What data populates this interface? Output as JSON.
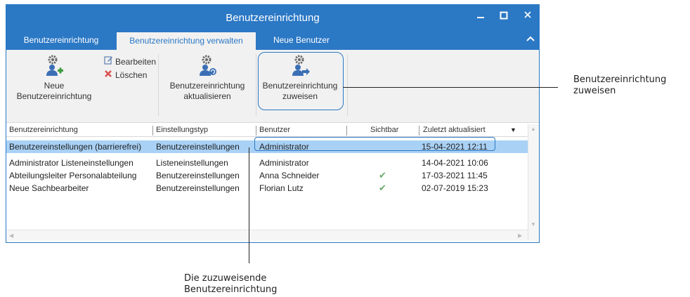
{
  "window": {
    "title": "Benutzereinrichtung",
    "controls": {
      "minimize": "‒",
      "maximize": "▫",
      "close": "✕"
    }
  },
  "tabs": [
    {
      "label": "Benutzereinrichtung",
      "active": false
    },
    {
      "label": "Benutzereinrichtung verwalten",
      "active": true
    },
    {
      "label": "Neue Benutzer",
      "active": false
    }
  ],
  "ribbon": {
    "neu_label_1": "Neue",
    "neu_label_2": "Benutzereinrichtung",
    "bearbeiten_label": "Bearbeiten",
    "loeschen_label": "Löschen",
    "aktualisieren_label_1": "Benutzereinrichtung",
    "aktualisieren_label_2": "aktualisieren",
    "zuweisen_label_1": "Benutzereinrichtung",
    "zuweisen_label_2": "zuweisen",
    "icons": {
      "neu": "gear-user-plus-icon",
      "bearbeiten": "edit-icon",
      "loeschen": "delete-x-icon",
      "aktualisieren": "gear-user-refresh-icon",
      "zuweisen": "gear-user-arrow-icon"
    }
  },
  "grid": {
    "columns": [
      "Benutzereinrichtung",
      "Einstellungstyp",
      "Benutzer",
      "Sichtbar",
      "Zuletzt aktualisiert"
    ],
    "rows": [
      {
        "name": "Benutzereinstellungen (barrierefrei)",
        "type": "Benutzereinstellungen",
        "user": "Administrator",
        "visible": "",
        "updated": "15-04-2021 12:11",
        "selected": true
      },
      {
        "name": "Administrator Listeneinstellungen",
        "type": "Listeneinstellungen",
        "user": "Administrator",
        "visible": "",
        "updated": "14-04-2021 10:06",
        "selected": false
      },
      {
        "name": "Abteilungsleiter Personalabteilung",
        "type": "Benutzereinstellungen",
        "user": "Anna Schneider",
        "visible": "✔",
        "updated": "17-03-2021 11:45",
        "selected": false
      },
      {
        "name": "Neue Sachbearbeiter",
        "type": "Benutzereinstellungen",
        "user": "Florian Lutz",
        "visible": "✔",
        "updated": "02-07-2019 15:23",
        "selected": false
      }
    ]
  },
  "callouts": {
    "right_1": "Benutzereinrichtung",
    "right_2": "zuweisen",
    "bottom_1": "Die zuzuweisende",
    "bottom_2": "Benutzereinrichtung"
  },
  "colors": {
    "accent": "#2b78c5",
    "selection": "#a9d1f5",
    "check": "#6aa86a"
  }
}
